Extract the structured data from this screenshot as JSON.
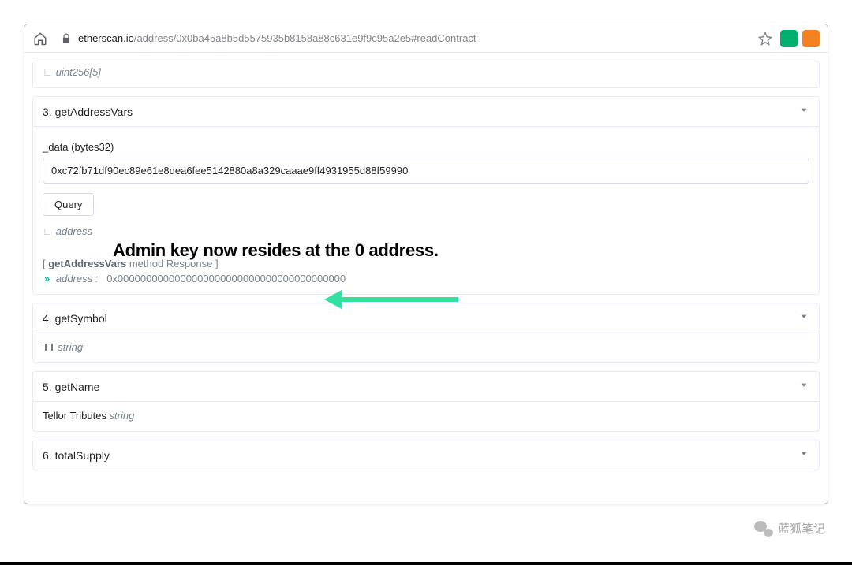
{
  "browser": {
    "url_host": "etherscan.io",
    "url_path": "/address/0x0ba45a8b5d5575935b8158a88c631e9f9c95a2e5#readContract"
  },
  "partial_top": {
    "tree": "∟",
    "type": "uint256[5]"
  },
  "panel3": {
    "title": "3. getAddressVars",
    "param_label": "_data (bytes32)",
    "input_value": "0xc72fb71df90ec89e61e8dea6fee5142880a8a329caaae9ff4931955d88f59990",
    "query_btn": "Query",
    "return_tree": "∟",
    "return_type": "address",
    "response_lead": "[ ",
    "response_method": "getAddressVars",
    "response_tail": " method Response ]",
    "result_arrow": "»",
    "result_type": "address",
    "result_value": "0x0000000000000000000000000000000000000000"
  },
  "panel4": {
    "title": "4. getSymbol",
    "value": "TT",
    "type": "string"
  },
  "panel5": {
    "title": "5. getName",
    "value": "Tellor Tributes",
    "type": "string"
  },
  "panel6": {
    "title": "6. totalSupply"
  },
  "annotation": {
    "text": "Admin key now resides at the 0 address."
  },
  "watermark": {
    "text": "蓝狐笔记"
  }
}
